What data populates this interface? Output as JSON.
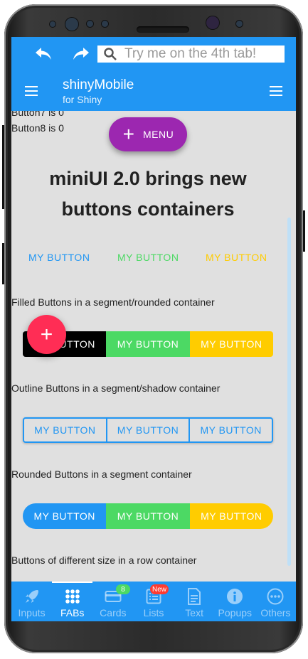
{
  "navbar": {
    "search_placeholder": "Try me on the 4th tab!",
    "title": "shinyMobile",
    "subtitle": "for Shiny"
  },
  "content": {
    "button7_text": "Button7 is 0",
    "button8_text": "Button8 is 0",
    "menu_fab_label": "MENU",
    "headline": "miniUI 2.0 brings new buttons containers",
    "plain_buttons": [
      {
        "label": "MY BUTTON",
        "color": "#2196f3"
      },
      {
        "label": "MY BUTTON",
        "color": "#4cd964"
      },
      {
        "label": "MY BUTTON",
        "color": "#ffcc00"
      }
    ],
    "filled_caption": "Filled Buttons in a segment/rounded container",
    "filled_buttons": [
      {
        "label": "MY BUTTON",
        "color": "#000000"
      },
      {
        "label": "MY BUTTON",
        "color": "#4cd964"
      },
      {
        "label": "MY BUTTON",
        "color": "#ffcc00"
      }
    ],
    "outline_caption": "Outline Buttons in a segment/shadow container",
    "outline_buttons": [
      {
        "label": "MY BUTTON"
      },
      {
        "label": "MY BUTTON"
      },
      {
        "label": "MY BUTTON"
      }
    ],
    "rounded_caption": "Rounded Buttons in a segment container",
    "rounded_buttons": [
      {
        "label": "MY BUTTON",
        "color": "#2196f3"
      },
      {
        "label": "MY BUTTON",
        "color": "#4cd964"
      },
      {
        "label": "MY BUTTON",
        "color": "#ffcc00"
      }
    ],
    "size_caption": "Buttons of different size in a row container"
  },
  "tabs": [
    {
      "label": "Inputs",
      "icon": "rocket-icon"
    },
    {
      "label": "FABs",
      "icon": "grid-icon",
      "active": true
    },
    {
      "label": "Cards",
      "icon": "card-icon",
      "badge": "8",
      "badge_color": "#4cd964"
    },
    {
      "label": "Lists",
      "icon": "list-icon",
      "badge": "New",
      "badge_color": "#ff3b30"
    },
    {
      "label": "Text",
      "icon": "document-icon"
    },
    {
      "label": "Popups",
      "icon": "info-icon"
    },
    {
      "label": "Others",
      "icon": "more-icon"
    }
  ],
  "colors": {
    "primary": "#2196f3",
    "menu_fab": "#9c27b0",
    "pink_fab": "#ff2d55"
  }
}
